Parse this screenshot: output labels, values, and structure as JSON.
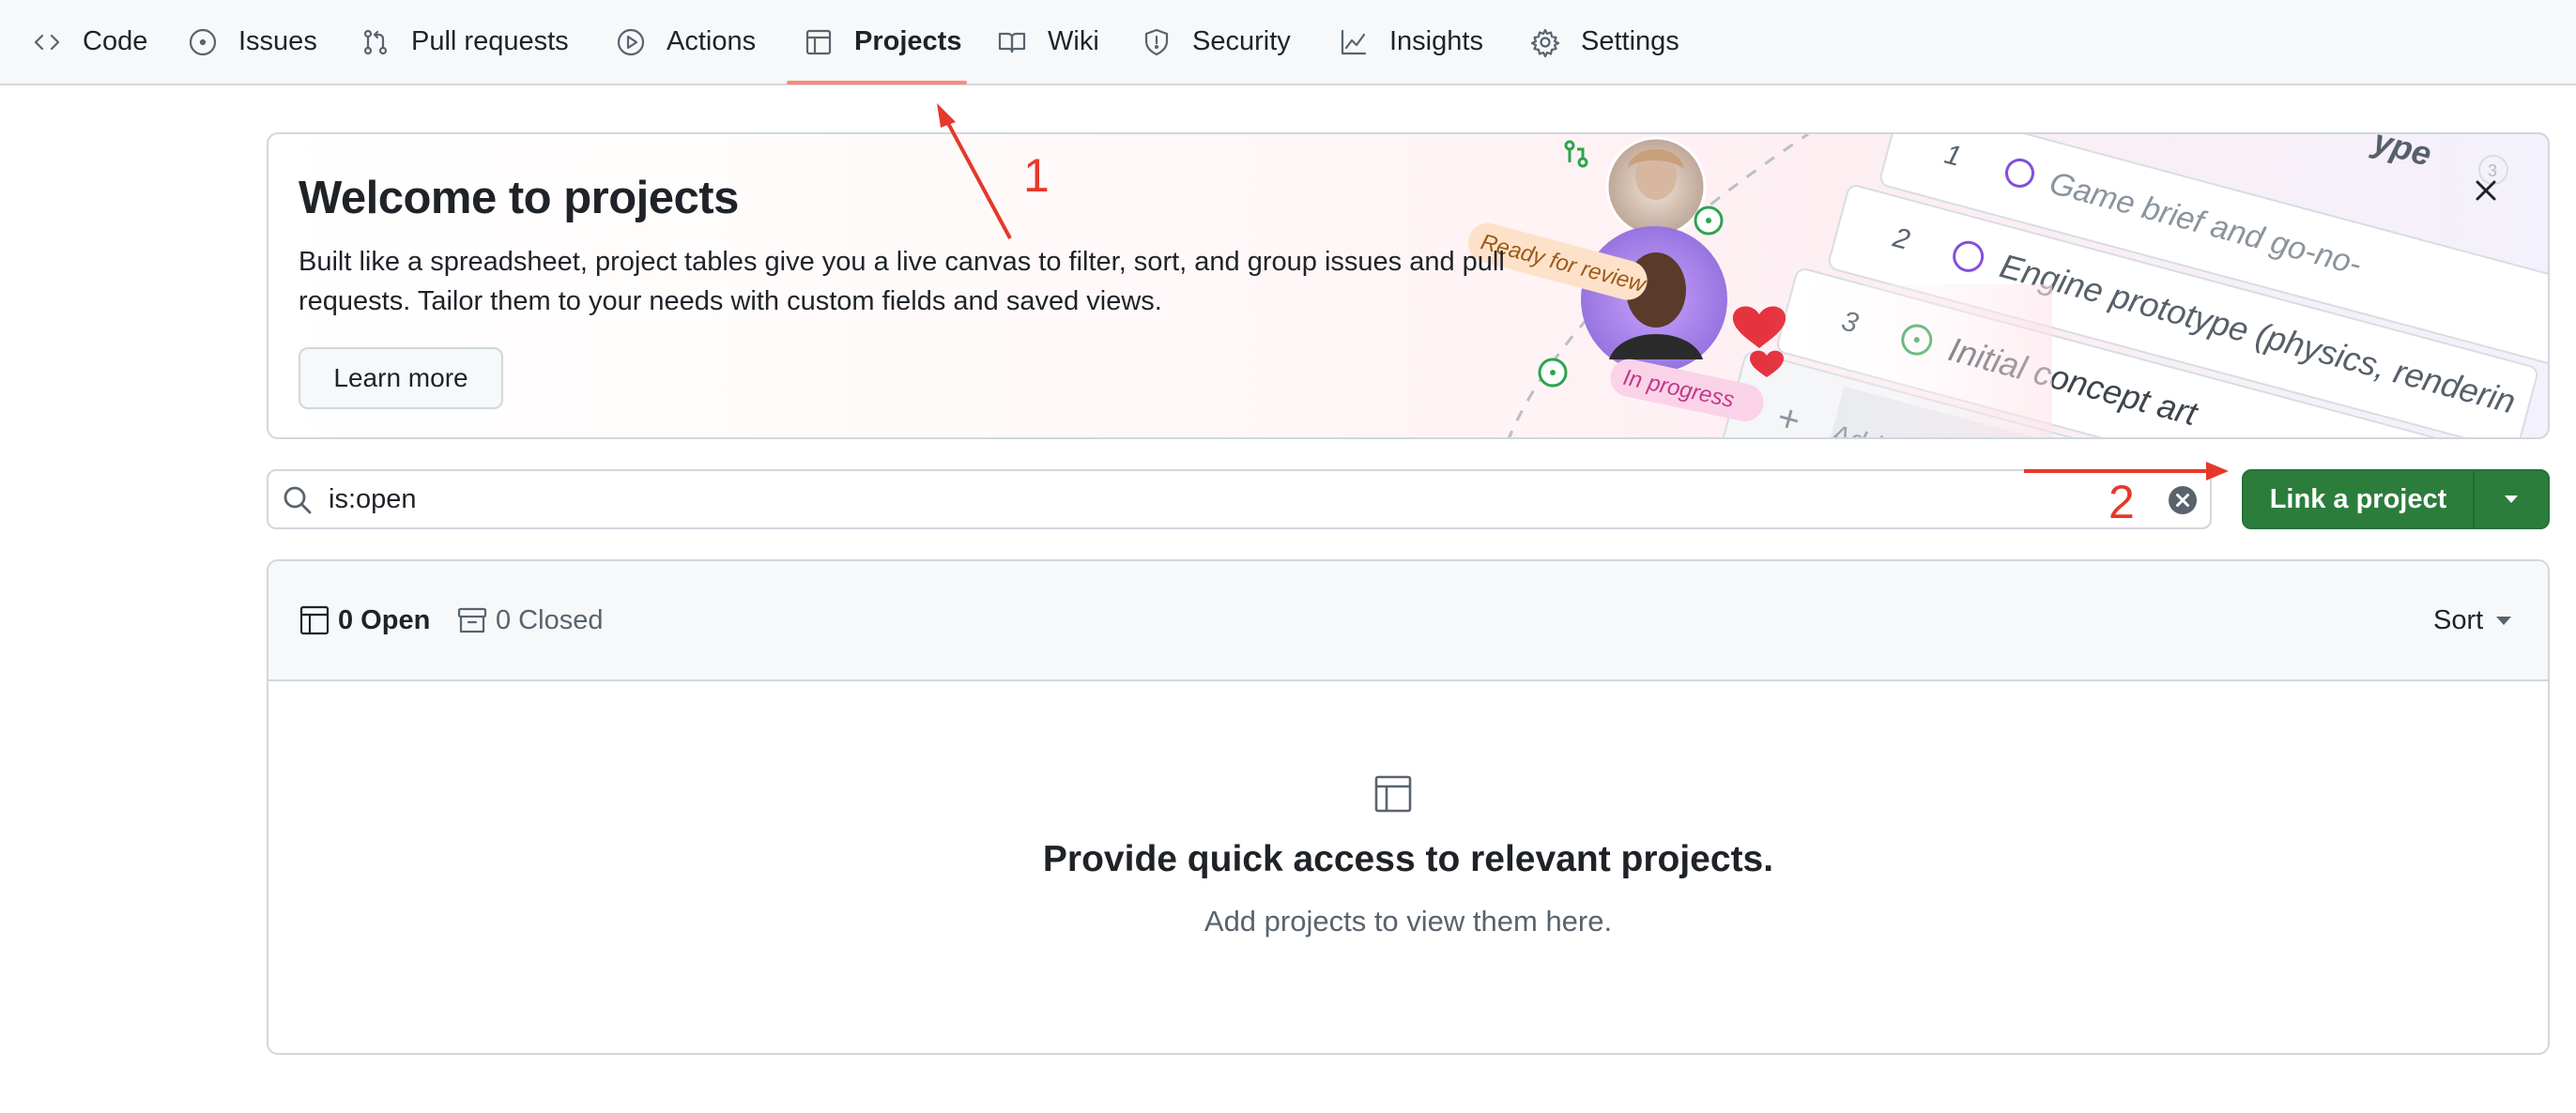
{
  "nav": {
    "tabs": [
      {
        "label": "Code",
        "icon": "code-icon"
      },
      {
        "label": "Issues",
        "icon": "issue-opened-icon"
      },
      {
        "label": "Pull requests",
        "icon": "git-pull-request-icon"
      },
      {
        "label": "Actions",
        "icon": "play-icon"
      },
      {
        "label": "Projects",
        "icon": "table-icon",
        "active": true
      },
      {
        "label": "Wiki",
        "icon": "book-icon"
      },
      {
        "label": "Security",
        "icon": "shield-icon"
      },
      {
        "label": "Insights",
        "icon": "graph-icon"
      },
      {
        "label": "Settings",
        "icon": "gear-icon"
      }
    ],
    "active_underline_color": "#fd8c73"
  },
  "banner": {
    "title": "Welcome to projects",
    "description": "Built like a spreadsheet, project tables give you a live canvas to filter, sort, and group issues and pull requests. Tailor them to your needs with custom fields and saved views.",
    "learn_more": "Learn more",
    "art": {
      "badge_review": "Ready for review",
      "badge_progress": "In progress",
      "rows": [
        {
          "num": "1",
          "text": "Game brief and go-no-"
        },
        {
          "num": "2",
          "text": "Engine prototype (physics, renderin"
        },
        {
          "num": "3",
          "text": "Initial concept art"
        }
      ],
      "add_item": "Add item",
      "corner_fragment": "ype",
      "corner_badge": "3"
    }
  },
  "search": {
    "value": "is:open"
  },
  "link_button": {
    "label": "Link a project",
    "color": "#2c7d3c"
  },
  "list": {
    "open_label": "0 Open",
    "closed_label": "0 Closed",
    "sort_label": "Sort",
    "empty_title": "Provide quick access to relevant projects.",
    "empty_subtitle": "Add projects to view them here."
  },
  "annotations": {
    "color": "#e5392b",
    "labels": [
      "1",
      "2"
    ]
  }
}
